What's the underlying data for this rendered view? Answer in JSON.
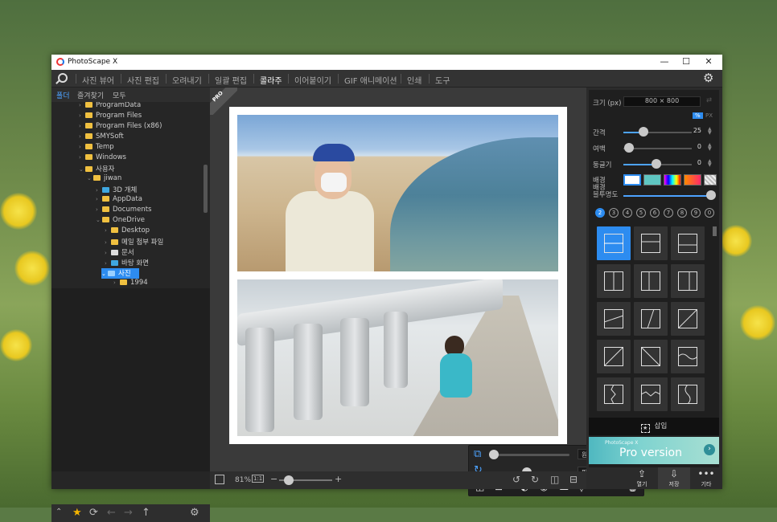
{
  "window": {
    "title": "PhotoScape X",
    "controls": {
      "min": "—",
      "max": "☐",
      "close": "✕"
    }
  },
  "menu": [
    "사진 뷰어",
    "사진 편집",
    "오려내기",
    "일괄 편집",
    "콜라주",
    "이어붙이기",
    "GIF 애니메이션",
    "인쇄",
    "도구"
  ],
  "menu_active": "콜라주",
  "left": {
    "tabs": [
      "폴더",
      "즐겨찾기",
      "모두"
    ],
    "tree": [
      {
        "label": "ProgramData",
        "level": 3
      },
      {
        "label": "Program Files",
        "level": 3
      },
      {
        "label": "Program Files (x86)",
        "level": 3
      },
      {
        "label": "SMYSoft",
        "level": 3
      },
      {
        "label": "Temp",
        "level": 3
      },
      {
        "label": "Windows",
        "level": 3
      },
      {
        "label": "사용자",
        "level": 3,
        "open": true
      },
      {
        "label": "jiwan",
        "level": 4,
        "open": true
      },
      {
        "label": "3D 개체",
        "level": 5
      },
      {
        "label": "AppData",
        "level": 5
      },
      {
        "label": "Documents",
        "level": 5
      },
      {
        "label": "OneDrive",
        "level": 5,
        "open": true
      },
      {
        "label": "Desktop",
        "level": 6
      },
      {
        "label": "메일 첨부 파일",
        "level": 6
      },
      {
        "label": "문서",
        "level": 6
      },
      {
        "label": "바탕 화면",
        "level": 6
      },
      {
        "label": "사진",
        "level": 6,
        "selected": true
      },
      {
        "label": "1994",
        "level": 7
      }
    ]
  },
  "canvas": {
    "pro_badge": "PRO",
    "zoom": "81%",
    "one_to_one": "1:1",
    "float_toolbar": {
      "color_mode": "원본 색상",
      "filter": "필름느낌"
    }
  },
  "right": {
    "size_label": "크기 (px)",
    "size_value": "800 × 800",
    "unit_percent": "%",
    "unit_px": "PX",
    "spacing_label": "간격",
    "spacing_value": "25",
    "margin_label": "여백",
    "margin_value": "0",
    "roundness_label": "둥글기",
    "roundness_value": "0",
    "background_label": "배경",
    "blur_label": "배경\n블투명도",
    "counts": [
      "2",
      "3",
      "4",
      "5",
      "6",
      "7",
      "8",
      "9",
      "0"
    ],
    "insert_label": "삽입",
    "pro_small": "PhotoScape X",
    "pro_big": "Pro version",
    "buttons": [
      "열기",
      "저장",
      "기타"
    ]
  },
  "colors": {
    "accent": "#2d8cf0",
    "window_bg": "#2b2b2b"
  }
}
